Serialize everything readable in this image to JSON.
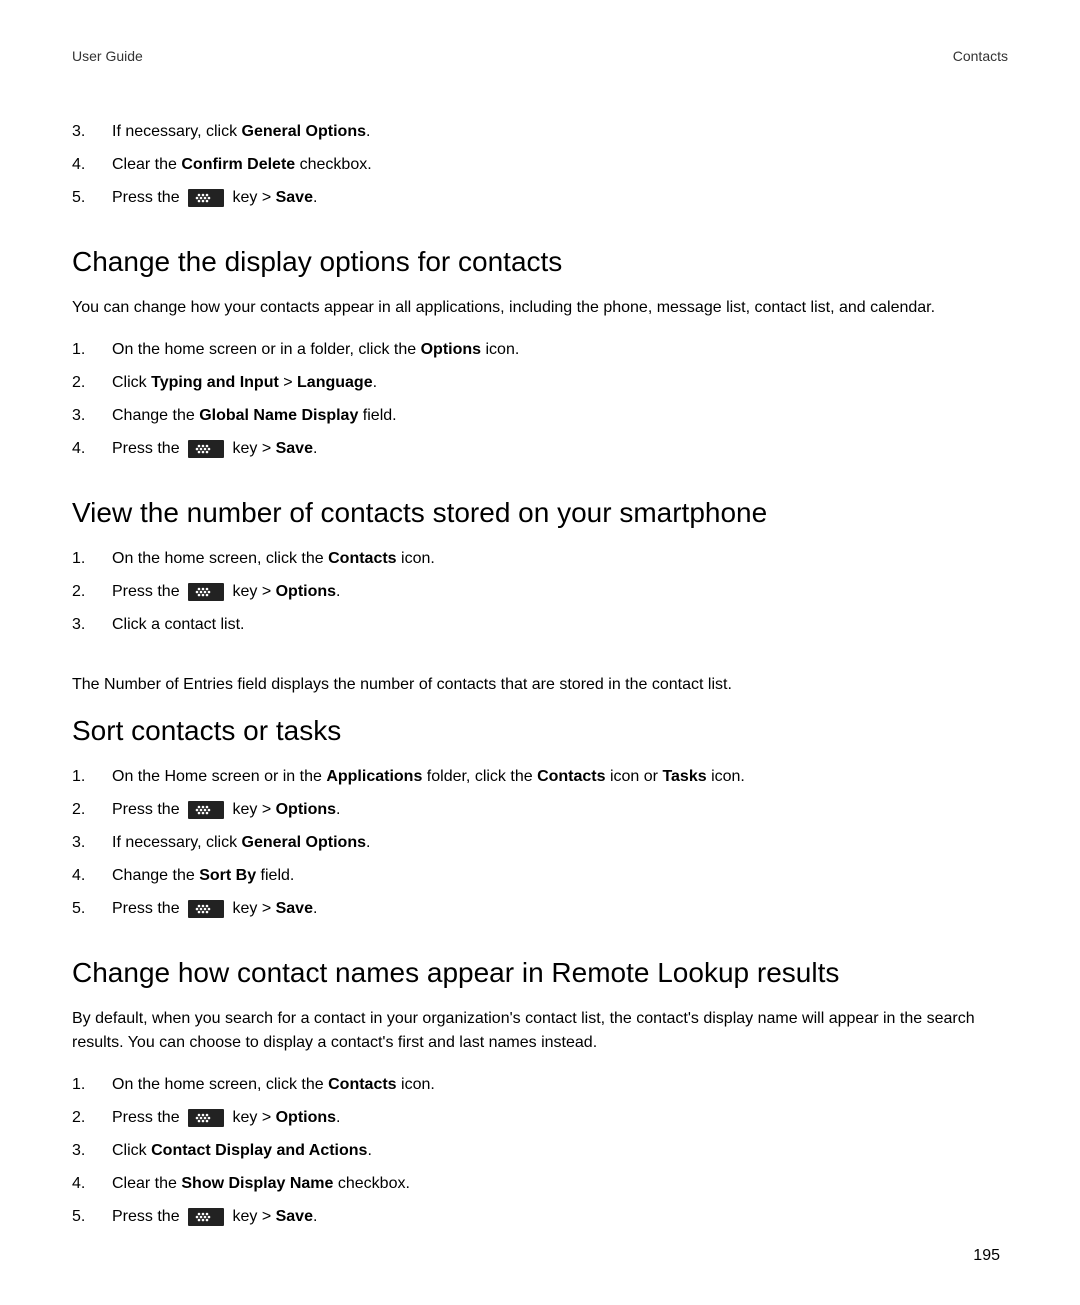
{
  "header": {
    "left": "User Guide",
    "right": "Contacts"
  },
  "page_number": "195",
  "top_steps": [
    {
      "num": "3.",
      "parts": [
        {
          "t": "If necessary, click "
        },
        {
          "t": "General Options",
          "bold": true
        },
        {
          "t": "."
        }
      ]
    },
    {
      "num": "4.",
      "parts": [
        {
          "t": "Clear the "
        },
        {
          "t": "Confirm Delete",
          "bold": true
        },
        {
          "t": " checkbox."
        }
      ]
    },
    {
      "num": "5.",
      "parts": [
        {
          "t": "Press the "
        },
        {
          "icon": "bb-key"
        },
        {
          "t": " key > "
        },
        {
          "t": "Save",
          "bold": true
        },
        {
          "t": "."
        }
      ]
    }
  ],
  "sections": [
    {
      "id": "change-display",
      "heading": "Change the display options for contacts",
      "intro": "You can change how your contacts appear in all applications, including the phone, message list, contact list, and calendar.",
      "steps": [
        {
          "num": "1.",
          "parts": [
            {
              "t": "On the home screen or in a folder, click the "
            },
            {
              "t": "Options",
              "bold": true
            },
            {
              "t": " icon."
            }
          ]
        },
        {
          "num": "2.",
          "parts": [
            {
              "t": "Click "
            },
            {
              "t": "Typing and Input",
              "bold": true
            },
            {
              "t": " > "
            },
            {
              "t": "Language",
              "bold": true
            },
            {
              "t": "."
            }
          ]
        },
        {
          "num": "3.",
          "parts": [
            {
              "t": "Change the "
            },
            {
              "t": "Global Name Display",
              "bold": true
            },
            {
              "t": " field."
            }
          ]
        },
        {
          "num": "4.",
          "parts": [
            {
              "t": "Press the "
            },
            {
              "icon": "bb-key"
            },
            {
              "t": " key > "
            },
            {
              "t": "Save",
              "bold": true
            },
            {
              "t": "."
            }
          ]
        }
      ]
    },
    {
      "id": "view-number",
      "heading": "View the number of contacts stored on your smartphone",
      "steps": [
        {
          "num": "1.",
          "parts": [
            {
              "t": "On the home screen, click the "
            },
            {
              "t": "Contacts",
              "bold": true
            },
            {
              "t": " icon."
            }
          ]
        },
        {
          "num": "2.",
          "parts": [
            {
              "t": "Press the "
            },
            {
              "icon": "bb-key"
            },
            {
              "t": " key > "
            },
            {
              "t": "Options",
              "bold": true
            },
            {
              "t": "."
            }
          ]
        },
        {
          "num": "3.",
          "parts": [
            {
              "t": "Click a contact list."
            }
          ]
        }
      ],
      "outro": "The Number of Entries field displays the number of contacts that are stored in the contact list."
    },
    {
      "id": "sort-contacts",
      "heading": "Sort contacts or tasks",
      "steps": [
        {
          "num": "1.",
          "parts": [
            {
              "t": "On the Home screen or in the "
            },
            {
              "t": "Applications",
              "bold": true
            },
            {
              "t": " folder, click the "
            },
            {
              "t": "Contacts",
              "bold": true
            },
            {
              "t": " icon or "
            },
            {
              "t": "Tasks",
              "bold": true
            },
            {
              "t": " icon."
            }
          ]
        },
        {
          "num": "2.",
          "parts": [
            {
              "t": "Press the "
            },
            {
              "icon": "bb-key"
            },
            {
              "t": " key > "
            },
            {
              "t": "Options",
              "bold": true
            },
            {
              "t": "."
            }
          ]
        },
        {
          "num": "3.",
          "parts": [
            {
              "t": "If necessary, click "
            },
            {
              "t": "General Options",
              "bold": true
            },
            {
              "t": "."
            }
          ]
        },
        {
          "num": "4.",
          "parts": [
            {
              "t": "Change the "
            },
            {
              "t": "Sort By",
              "bold": true
            },
            {
              "t": " field."
            }
          ]
        },
        {
          "num": "5.",
          "parts": [
            {
              "t": "Press the "
            },
            {
              "icon": "bb-key"
            },
            {
              "t": " key > "
            },
            {
              "t": "Save",
              "bold": true
            },
            {
              "t": "."
            }
          ]
        }
      ]
    },
    {
      "id": "remote-lookup",
      "heading": "Change how contact names appear in Remote Lookup results",
      "intro": "By default, when you search for a contact in your organization's contact list, the contact's display name will appear in the search results. You can choose to display a contact's first and last names instead.",
      "steps": [
        {
          "num": "1.",
          "parts": [
            {
              "t": "On the home screen, click the "
            },
            {
              "t": "Contacts",
              "bold": true
            },
            {
              "t": " icon."
            }
          ]
        },
        {
          "num": "2.",
          "parts": [
            {
              "t": "Press the "
            },
            {
              "icon": "bb-key"
            },
            {
              "t": " key > "
            },
            {
              "t": "Options",
              "bold": true
            },
            {
              "t": "."
            }
          ]
        },
        {
          "num": "3.",
          "parts": [
            {
              "t": "Click "
            },
            {
              "t": "Contact Display and Actions",
              "bold": true
            },
            {
              "t": "."
            }
          ]
        },
        {
          "num": "4.",
          "parts": [
            {
              "t": "Clear the "
            },
            {
              "t": "Show Display Name",
              "bold": true
            },
            {
              "t": " checkbox."
            }
          ]
        },
        {
          "num": "5.",
          "parts": [
            {
              "t": "Press the "
            },
            {
              "icon": "bb-key"
            },
            {
              "t": " key > "
            },
            {
              "t": "Save",
              "bold": true
            },
            {
              "t": "."
            }
          ]
        }
      ]
    }
  ]
}
